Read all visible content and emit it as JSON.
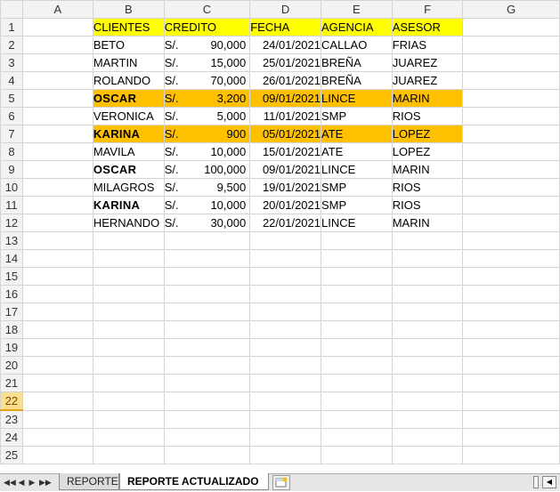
{
  "columns": [
    "A",
    "B",
    "C",
    "D",
    "E",
    "F",
    "G"
  ],
  "rows": [
    "1",
    "2",
    "3",
    "4",
    "5",
    "6",
    "7",
    "8",
    "9",
    "10",
    "11",
    "12",
    "13",
    "14",
    "15",
    "16",
    "17",
    "18",
    "19",
    "20",
    "21",
    "22",
    "23",
    "24",
    "25"
  ],
  "headers": {
    "clientes": "CLIENTES",
    "credito": "CREDITO",
    "fecha": "FECHA",
    "agencia": "AGENCIA",
    "asesor": "ASESOR"
  },
  "records": [
    {
      "cliente": "BETO",
      "cur": "S/.",
      "monto": "90,000",
      "fecha": "24/01/2021",
      "agencia": "CALLAO",
      "asesor": "FRIAS"
    },
    {
      "cliente": "MARTIN",
      "cur": "S/.",
      "monto": "15,000",
      "fecha": "25/01/2021",
      "agencia": "BREÑA",
      "asesor": "JUAREZ"
    },
    {
      "cliente": "ROLANDO",
      "cur": "S/.",
      "monto": "70,000",
      "fecha": "26/01/2021",
      "agencia": "BREÑA",
      "asesor": "JUAREZ"
    },
    {
      "cliente": "OSCAR",
      "cur": "S/.",
      "monto": "3,200",
      "fecha": "09/01/2021",
      "agencia": "LINCE",
      "asesor": "MARIN"
    },
    {
      "cliente": "VERONICA",
      "cur": "S/.",
      "monto": "5,000",
      "fecha": "11/01/2021",
      "agencia": "SMP",
      "asesor": "RIOS"
    },
    {
      "cliente": "KARINA",
      "cur": "S/.",
      "monto": "900",
      "fecha": "05/01/2021",
      "agencia": "ATE",
      "asesor": "LOPEZ"
    },
    {
      "cliente": "MAVILA",
      "cur": "S/.",
      "monto": "10,000",
      "fecha": "15/01/2021",
      "agencia": "ATE",
      "asesor": "LOPEZ"
    },
    {
      "cliente": "OSCAR",
      "cur": "S/.",
      "monto": "100,000",
      "fecha": "09/01/2021",
      "agencia": "LINCE",
      "asesor": "MARIN"
    },
    {
      "cliente": "MILAGROS",
      "cur": "S/.",
      "monto": "9,500",
      "fecha": "19/01/2021",
      "agencia": "SMP",
      "asesor": "RIOS"
    },
    {
      "cliente": "KARINA",
      "cur": "S/.",
      "monto": "10,000",
      "fecha": "20/01/2021",
      "agencia": "SMP",
      "asesor": "RIOS"
    },
    {
      "cliente": "HERNANDO",
      "cur": "S/.",
      "monto": "30,000",
      "fecha": "22/01/2021",
      "agencia": "LINCE",
      "asesor": "MARIN"
    }
  ],
  "tabs": {
    "reporte": "REPORTE",
    "reporte_actualizado": "REPORTE ACTUALIZADO"
  },
  "nav": {
    "first": "◀◀",
    "prev": "◀",
    "next": "▶",
    "last": "▶▶",
    "scroll_left": "◀"
  },
  "colors": {
    "header_fill": "#ffff00",
    "highlight_fill": "#ffc000",
    "active_row": "#fbdf8e"
  },
  "active_row": "22",
  "active_tab": "REPORTE ACTUALIZADO"
}
